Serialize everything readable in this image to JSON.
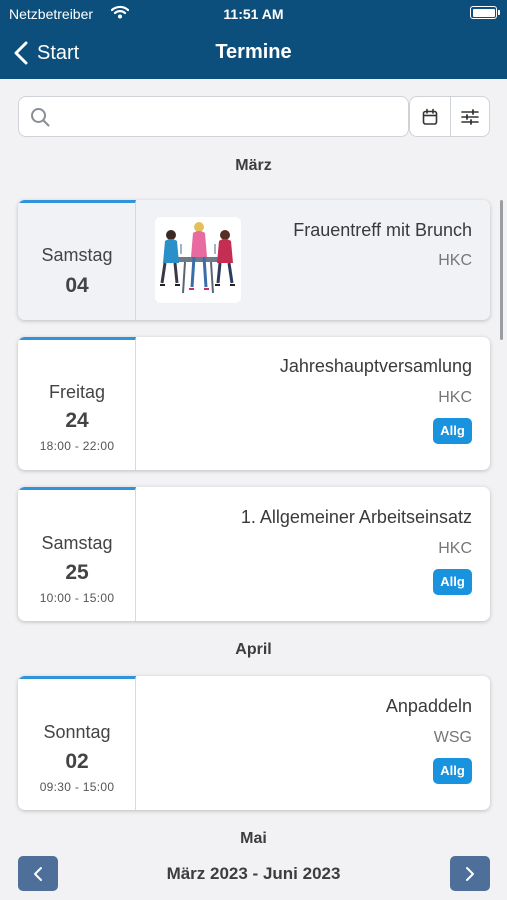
{
  "status_bar": {
    "carrier": "Netzbetreiber",
    "time": "11:51 AM"
  },
  "nav": {
    "back_label": "Start",
    "title": "Termine"
  },
  "search": {
    "value": "",
    "placeholder": ""
  },
  "months": [
    "März",
    "April",
    "Mai"
  ],
  "events": [
    {
      "weekday": "Samstag",
      "day": "04",
      "time": "",
      "title": "Frauentreff mit Brunch",
      "organizer": "HKC",
      "badge": "",
      "has_image": true
    },
    {
      "weekday": "Freitag",
      "day": "24",
      "time": "18:00 - 22:00",
      "title": "Jahreshauptversamlung",
      "organizer": "HKC",
      "badge": "Allg"
    },
    {
      "weekday": "Samstag",
      "day": "25",
      "time": "10:00 - 15:00",
      "title": "1. Allgemeiner Arbeitseinsatz",
      "organizer": "HKC",
      "badge": "Allg"
    },
    {
      "weekday": "Sonntag",
      "day": "02",
      "time": "09:30 - 15:00",
      "title": "Anpaddeln",
      "organizer": "WSG",
      "badge": "Allg"
    }
  ],
  "pager": {
    "range": "März 2023 - Juni 2023"
  },
  "colors": {
    "header": "#0d4f7c",
    "accent": "#2f95d8",
    "badge": "#1a93de",
    "pager_button": "#4d6f99"
  }
}
